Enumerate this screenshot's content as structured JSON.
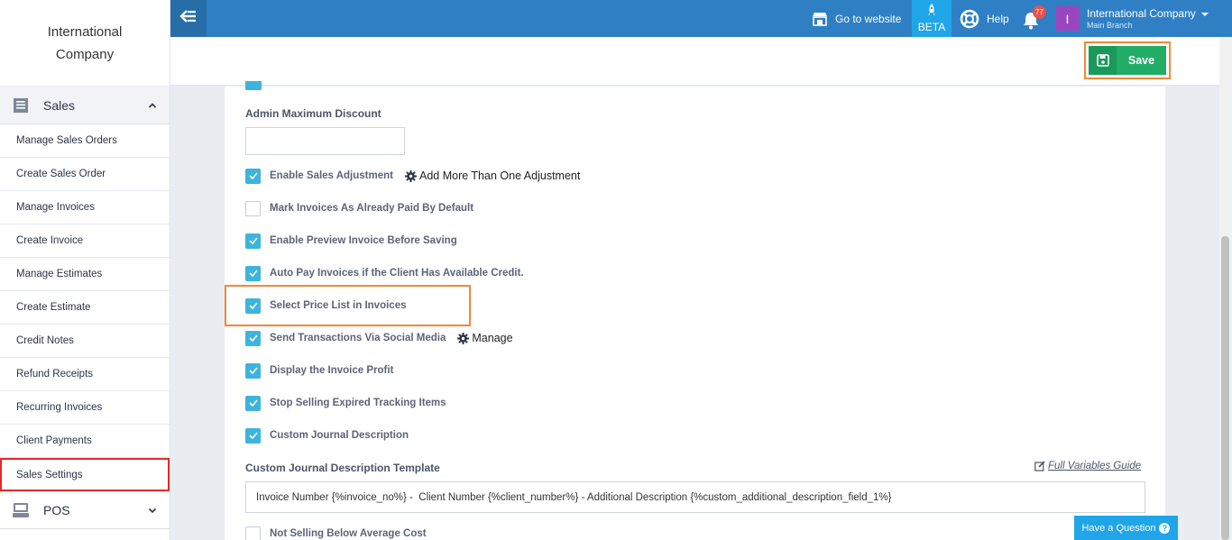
{
  "brand": {
    "line1": "International",
    "line2": "Company"
  },
  "sidebar": {
    "sales_section": {
      "label": "Sales",
      "icon": "receipt-icon"
    },
    "items": [
      {
        "label": "Manage Sales Orders"
      },
      {
        "label": "Create Sales Order"
      },
      {
        "label": "Manage Invoices"
      },
      {
        "label": "Create Invoice"
      },
      {
        "label": "Manage Estimates"
      },
      {
        "label": "Create Estimate"
      },
      {
        "label": "Credit Notes"
      },
      {
        "label": "Refund Receipts"
      },
      {
        "label": "Recurring Invoices"
      },
      {
        "label": "Client Payments"
      },
      {
        "label": "Sales Settings",
        "active": true
      }
    ],
    "pos_section": {
      "label": "POS",
      "icon": "pos-terminal-icon"
    }
  },
  "topbar": {
    "go_to_website": "Go to website",
    "beta": "BETA",
    "help": "Help",
    "notification_count": "77",
    "user_initial": "I",
    "user_name": "International Company",
    "branch": "Main Branch",
    "color": "#2f7fc4"
  },
  "actionbar": {
    "save_label": "Save",
    "save_color": "#22ad67"
  },
  "form": {
    "admin_max_discount_label": "Admin Maximum Discount",
    "admin_max_discount_value": "",
    "checkboxes": [
      {
        "label": "Enable Sales Adjustment",
        "checked": true,
        "extra": "Add More Than One Adjustment"
      },
      {
        "label": "Mark Invoices As Already Paid By Default",
        "checked": false
      },
      {
        "label": "Enable Preview Invoice Before Saving",
        "checked": true
      },
      {
        "label": "Auto Pay Invoices if the Client Has Available Credit.",
        "checked": true
      },
      {
        "label": "Select Price List in Invoices",
        "checked": true
      },
      {
        "label": "Send Transactions Via Social Media",
        "checked": true,
        "extra": "Manage"
      },
      {
        "label": "Display the Invoice Profit",
        "checked": true
      },
      {
        "label": "Stop Selling Expired Tracking Items",
        "checked": true
      },
      {
        "label": "Custom Journal Description",
        "checked": true
      }
    ],
    "template_label": "Custom Journal Description Template",
    "template_guide": "Full Variables Guide",
    "template_value": "Invoice Number {%invoice_no%} -  Client Number {%client_number%} - Additional Description {%custom_additional_description_field_1%}",
    "last_checkbox": {
      "label": "Not Selling Below Average Cost",
      "checked": false
    }
  },
  "help_widget": {
    "label": "Have a Question"
  }
}
